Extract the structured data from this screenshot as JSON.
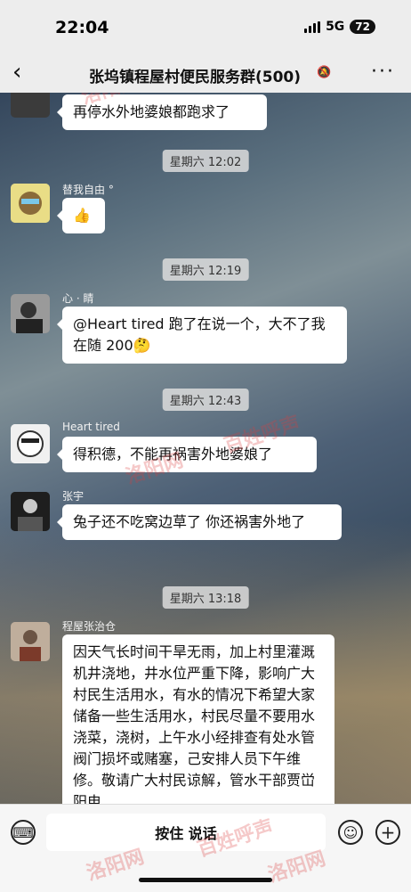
{
  "status_bar": {
    "time": "22:04",
    "network": "5G",
    "battery": "72"
  },
  "header": {
    "back_icon": "chevron-left-icon",
    "title": "张坞镇程屋村便民服务群(500)",
    "mute_icon": "bell-off-icon",
    "more_icon": "more-icon"
  },
  "messages": [
    {
      "type": "text",
      "text": "再停水外地婆娘都跑求了"
    },
    {
      "type": "timestamp",
      "text": "星期六 12:02"
    },
    {
      "type": "text",
      "sender": "替我自由 °",
      "text": "👍"
    },
    {
      "type": "timestamp",
      "text": "星期六 12:19"
    },
    {
      "type": "text",
      "sender": "心 · 睛",
      "text": "@Heart tired 跑了在说一个，大不了我在随 200🤔"
    },
    {
      "type": "timestamp",
      "text": "星期六 12:43"
    },
    {
      "type": "text",
      "sender": "Heart tired",
      "text": "得积德，不能再祸害外地婆娘了"
    },
    {
      "type": "text",
      "sender": "张宇",
      "text": "兔子还不吃窝边草了 你还祸害外地了"
    },
    {
      "type": "timestamp",
      "text": "星期六 13:18"
    },
    {
      "type": "text",
      "sender": "程屋张治仓",
      "text": "因天气长时间干旱无雨，加上村里灌溉机井浇地，井水位严重下降，影响广大村民生活用水，有水的情况下希望大家储备一些生活用水，村民尽量不要用水浇菜，浇树，上午水小经排查有处水管阀门损坏或赌塞，己安排人员下午维修。敬请广大村民谅解，管水干部贾峃阳电"
    }
  ],
  "input_bar": {
    "voice_icon": "keyboard-icon",
    "hold_to_talk": "按住 说话",
    "emoji_icon": "emoji-icon",
    "plus_icon": "plus-icon"
  },
  "watermarks": [
    "洛阳网",
    "百姓呼声"
  ]
}
